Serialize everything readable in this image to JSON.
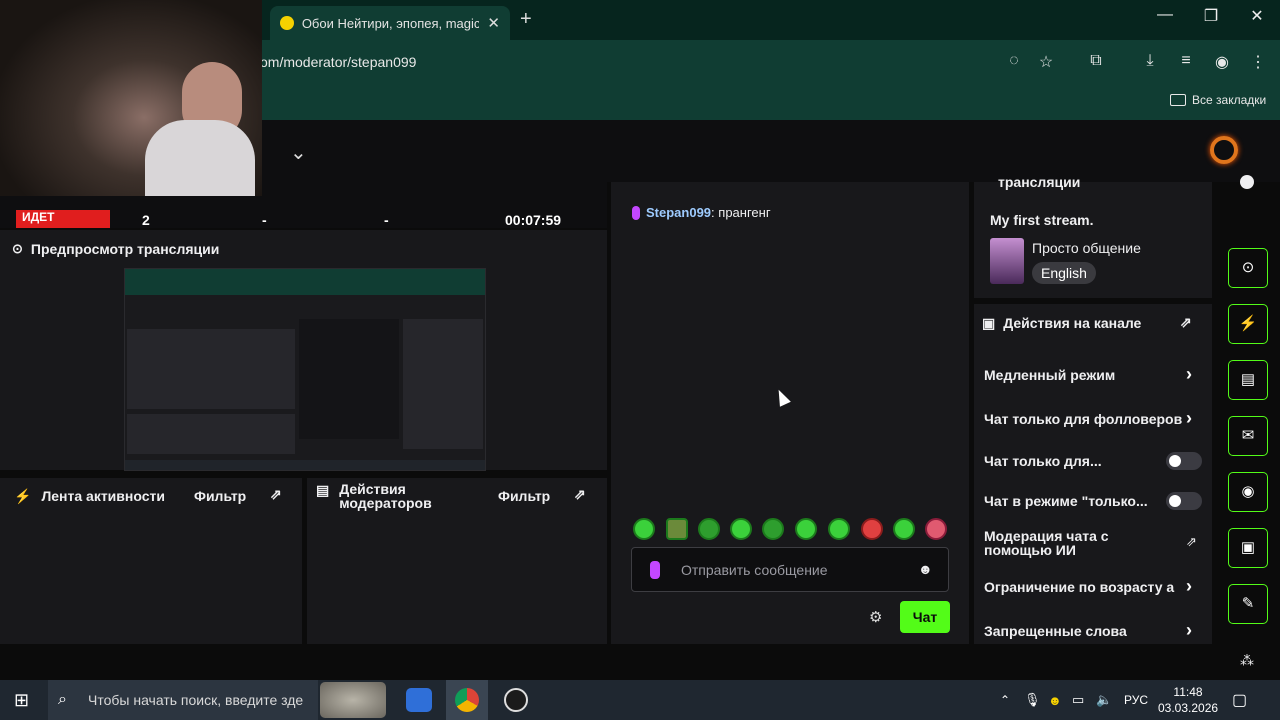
{
  "browser": {
    "tab_title": "Обои Нейтири, эпопея, magic",
    "url": "om/moderator/stepan099",
    "bookmarks_label": "Все закладки"
  },
  "stats": {
    "live_label": "ИДЕТ",
    "viewers": "2",
    "followers": "-",
    "subs": "-",
    "duration": "00:07:59"
  },
  "preview": {
    "title": "Предпросмотр трансляции"
  },
  "activity": {
    "title": "Лента активности",
    "filter": "Фильтр"
  },
  "mod_actions": {
    "title_line1": "Действия",
    "title_line2": "модераторов",
    "filter": "Фильтр"
  },
  "chat": {
    "messages": [
      {
        "user": "Stepan099",
        "text": "прангенг"
      }
    ],
    "input_placeholder": "Отправить сообщение",
    "send_label": "Чат"
  },
  "stream_info": {
    "heading_partial": "трансляции",
    "title": "My first stream.",
    "category": "Просто общение",
    "language": "English"
  },
  "channel_actions": {
    "title": "Действия на канале",
    "items": [
      {
        "label": "Медленный режим",
        "control": "arrow"
      },
      {
        "label": "Чат только для фолловеров",
        "control": "arrow"
      },
      {
        "label": "Чат только для...",
        "control": "toggle"
      },
      {
        "label": "Чат в режиме \"только...",
        "control": "toggle"
      },
      {
        "label_line1": "Модерация чата с",
        "label_line2": "помощью ИИ",
        "control": "external"
      },
      {
        "label": "Ограничение по возрасту а",
        "control": "arrow"
      },
      {
        "label": "Запрещенные слова",
        "control": "arrow"
      }
    ]
  },
  "taskbar": {
    "search_placeholder": "Чтобы начать поиск, введите зде",
    "lang": "РУС",
    "time": "11:48",
    "date": "03.03.2026"
  },
  "colors": {
    "accent": "#53fc18",
    "live": "#e01e1e",
    "mic": "#c347ff"
  }
}
